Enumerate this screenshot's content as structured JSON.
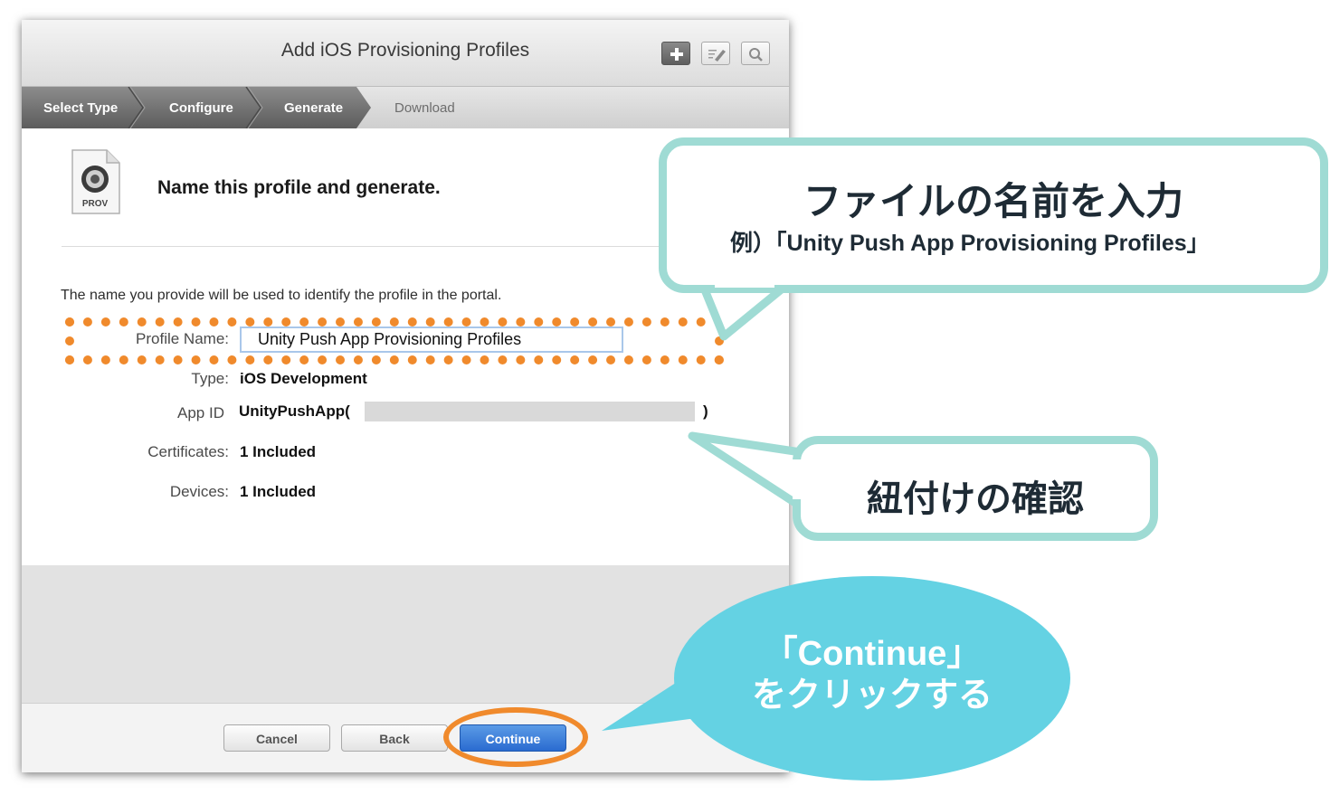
{
  "window": {
    "title": "Add iOS Provisioning Profiles",
    "toolbar": [
      "plus-icon",
      "edit-icon",
      "search-icon"
    ]
  },
  "steps": [
    {
      "label": "Select Type",
      "state": "done"
    },
    {
      "label": "Configure",
      "state": "done"
    },
    {
      "label": "Generate",
      "state": "current"
    },
    {
      "label": "Download",
      "state": "todo"
    }
  ],
  "prov_icon_label": "PROV",
  "heading": "Name this profile and generate.",
  "description": "The name you provide will be used to identify the profile in the portal.",
  "form": {
    "profile_name_label": "Profile Name:",
    "profile_name_value": "Unity Push App Provisioning Profiles",
    "type_label": "Type:",
    "type_value": "iOS Development",
    "app_id_label": "App ID",
    "app_id_value": "UnityPushApp(",
    "app_id_close": ")",
    "certificates_label": "Certificates:",
    "certificates_value": "1 Included",
    "devices_label": "Devices:",
    "devices_value": "1 Included"
  },
  "buttons": {
    "cancel": "Cancel",
    "back": "Back",
    "continue": "Continue"
  },
  "annotations": {
    "callout1_title": "ファイルの名前を入力",
    "callout1_sub": "例）「Unity Push App Provisioning Profiles」",
    "callout2_title": "紐付けの確認",
    "bubble_line1": "「Continue」",
    "bubble_line2": "をクリックする"
  },
  "colors": {
    "orange": "#f08a2c",
    "teal_border": "#9fdbd4",
    "bubble": "#64d2e3",
    "primary_button": "#2a6bd0"
  }
}
